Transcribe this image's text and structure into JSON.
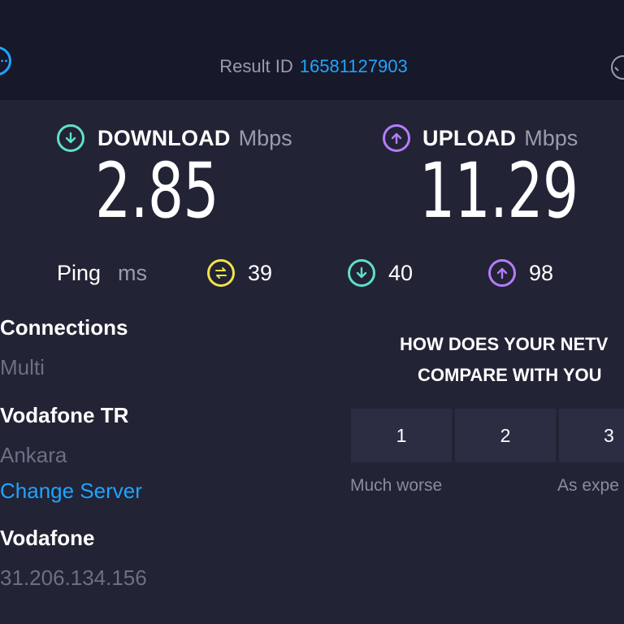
{
  "header": {
    "result_label": "Result ID",
    "result_id": "16581127903"
  },
  "download": {
    "title": "DOWNLOAD",
    "unit": "Mbps",
    "value": "2.85",
    "color": "#5fe0c9"
  },
  "upload": {
    "title": "UPLOAD",
    "unit": "Mbps",
    "value": "11.29",
    "color": "#b47dfb"
  },
  "ping": {
    "label": "Ping",
    "unit": "ms",
    "idle": "39",
    "download": "40",
    "upload": "98",
    "idle_color": "#f2e24a"
  },
  "connection": {
    "connections_label": "Connections",
    "connections_value": "Multi",
    "server_name": "Vodafone TR",
    "server_location": "Ankara",
    "change_server": "Change Server",
    "isp_name": "Vodafone",
    "ip_address": "31.206.134.156"
  },
  "survey": {
    "question_line1": "HOW DOES YOUR NETV",
    "question_line2": "COMPARE WITH YOU",
    "options": [
      "1",
      "2",
      "3"
    ],
    "caption_low": "Much worse",
    "caption_mid": "As expe"
  },
  "colors": {
    "accent_link": "#1fa4ff",
    "background": "#222335",
    "topbar": "#171829"
  }
}
